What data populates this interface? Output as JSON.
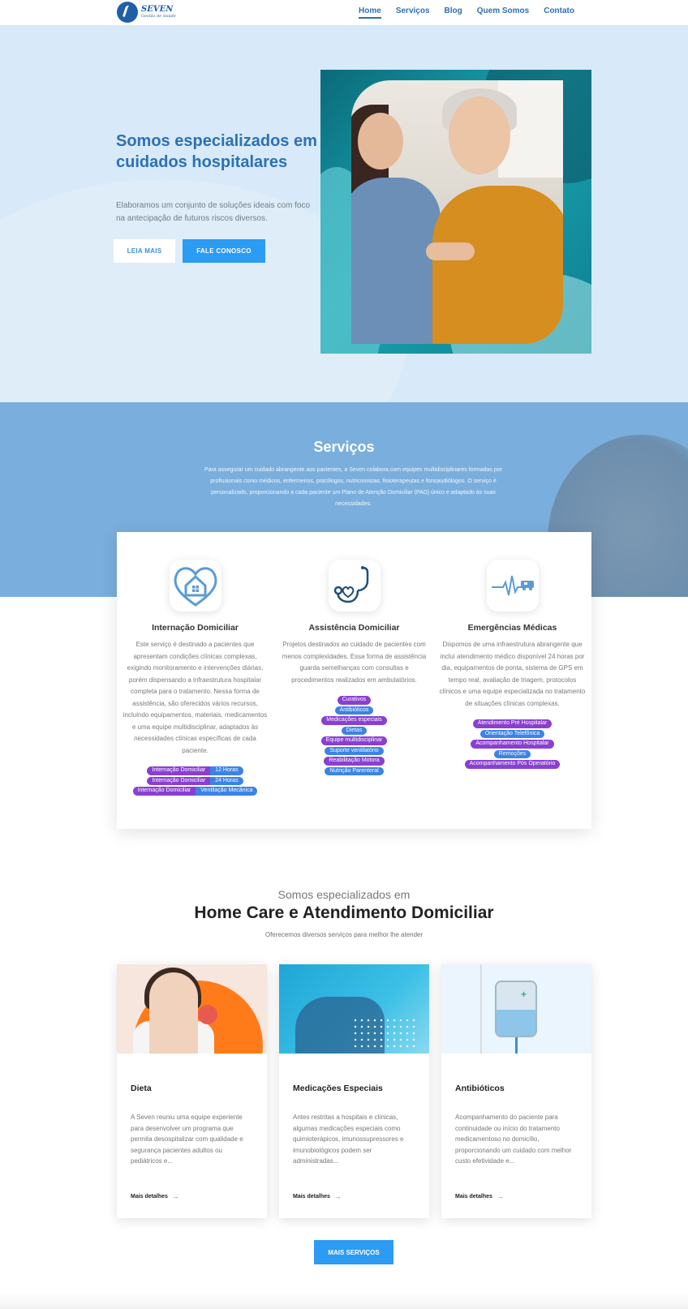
{
  "brand": {
    "name": "SEVEN",
    "tagline": "Gestão de Saúde"
  },
  "nav": {
    "items": [
      "Home",
      "Serviços",
      "Blog",
      "Quem Somos",
      "Contato"
    ],
    "active": "Home"
  },
  "hero": {
    "title": "Somos especializados em cuidados hospitalares",
    "subtitle": "Elaboramos um conjunto de soluções ideais com foco na antecipação de futuros riscos diversos.",
    "btn_read": "LEIA MAIS",
    "btn_contact": "FALE CONOSCO"
  },
  "services": {
    "title": "Serviços",
    "text": "Para assegurar um cuidado abrangente aos pacientes, a Seven colabora com equipes multidisciplinares formadas por profissionais como médicos, enfermeiros, psicólogos, nutricionistas, fisioterapeutas e fonoaudiólogos. O serviço é personalizado, proporcionando a cada paciente um Plano de Atenção Domiciliar (PAD) único e adaptado às suas necessidades.",
    "columns": [
      {
        "icon": "house-heart-icon",
        "title": "Internação Domiciliar",
        "text": "Este serviço é destinado a pacientes que apresentam condições clínicas complexas, exigindo monitoramento e intervenções diárias, porém dispensando a infraestrutura hospitalar completa para o tratamento. Nessa forma de assistência, são oferecidos vários recursos, incluindo equipamentos, materiais, medicamentos e uma equipe multidisciplinar, adaptados às necessidades clínicas específicas de cada paciente.",
        "tags": [
          {
            "a": "Internação Domiciliar",
            "b": "12 Horas"
          },
          {
            "a": "Internação Domiciliar",
            "b": "24 Horas"
          },
          {
            "a": "Internação Domiciliar",
            "b": "Ventilação Mecânica"
          }
        ]
      },
      {
        "icon": "stethoscope-icon",
        "title": "Assistência Domiciliar",
        "text": "Projetos destinados ao cuidado de pacientes com menos complexidades. Essa forma de assistência guarda semelhanças com consultas e procedimentos realizados em ambulatórios.",
        "tags": [
          "Curativos",
          "Antibióticos",
          "Medicações especiais",
          "Dietas",
          "Equipe multidisciplinar",
          "Suporte ventilatório",
          "Reabilitação Motora",
          "Nutrição Parenteral"
        ]
      },
      {
        "icon": "ambulance-pulse-icon",
        "title": "Emergências Médicas",
        "text": "Dispomos de uma infraestrutura abrangente que inclui atendimento médico disponível 24 horas por dia, equipamentos de ponta, sistema de GPS em tempo real, avaliação de triagem, protocolos clínicos e uma equipe especializada no tratamento de situações clínicas complexas.",
        "tags": [
          "Atendimento Pré Hospitalar",
          "Orientação Telefônica",
          "Acompanhamento Hospitalar",
          "Remoções",
          "Acompanhamento Pós Operatório"
        ]
      }
    ]
  },
  "homecare": {
    "pre": "Somos especializados em",
    "title": "Home Care e Atendimento Domiciliar",
    "subtitle": "Oferecemos diversos serviços para melhor lhe atender",
    "cards": [
      {
        "title": "Dieta",
        "text": "A Seven reuniu uma equipe experiente para desenvolver um programa que permita desospitalizar com qualidade e segurança pacientes adultos ou pediátricos e...",
        "more": "Mais detalhes"
      },
      {
        "title": "Medicações Especiais",
        "text": "Antes restritas a hospitais e clínicas, algumas medicações especiais como quimioterápicos, imunossupressores e imunobiológicos podem ser administradas...",
        "more": "Mais detalhes"
      },
      {
        "title": "Antibióticos",
        "text": "Acompanhamento do paciente para continuidade ou início do tratamento medicamentoso no domicílio, proporcionando um cuidado com melhor custo efetividade e...",
        "more": "Mais detalhes"
      }
    ],
    "more_button": "MAIS SERVIÇOS"
  },
  "colors": {
    "primary": "#2b71b3",
    "accent": "#2b9bf4",
    "tag_purple": "#8a3fd1",
    "tag_blue": "#3b83e6",
    "services_bg": "#7aaedc",
    "hero_bg": "#d8e9f9"
  }
}
